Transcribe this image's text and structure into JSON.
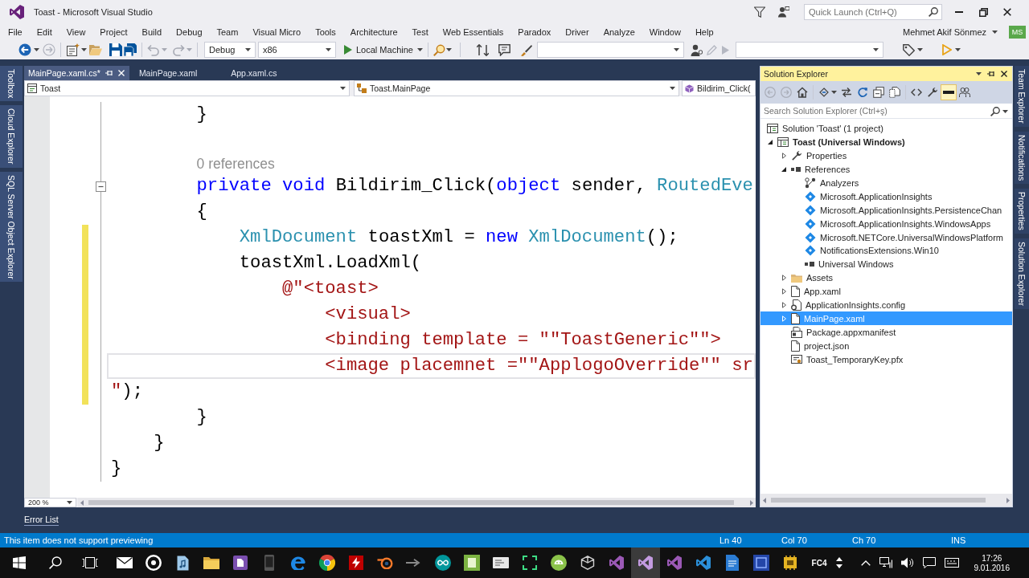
{
  "window": {
    "title": "Toast - Microsoft Visual Studio",
    "quick_launch": {
      "placeholder": "Quick Launch (Ctrl+Q)"
    }
  },
  "menu": {
    "items": [
      "File",
      "Edit",
      "View",
      "Project",
      "Build",
      "Debug",
      "Team",
      "Visual Micro",
      "Tools",
      "Architecture",
      "Test",
      "Web Essentials",
      "Paradox",
      "Driver",
      "Analyze",
      "Window",
      "Help"
    ],
    "user": "Mehmet Akif Sönmez",
    "avatar_initials": "MS"
  },
  "toolbar": {
    "configuration": "Debug",
    "platform": "x86",
    "start_target": "Local Machine"
  },
  "left_dock_tabs": [
    "Toolbox",
    "Cloud Explorer",
    "SQL Server Object Explorer"
  ],
  "document_tabs": [
    {
      "label": "MainPage.xaml.cs*",
      "selected": true
    },
    {
      "label": "MainPage.xaml",
      "selected": false
    },
    {
      "label": "App.xaml.cs",
      "selected": false
    }
  ],
  "navigation_bar": {
    "project": "Toast",
    "type": "Toast.MainPage",
    "member": "Bildirim_Click("
  },
  "editor": {
    "lines": [
      {
        "kind": "code",
        "tokens": [
          {
            "kind": "plain",
            "text": "        }"
          }
        ],
        "current": false,
        "changed": false,
        "foldable": false
      },
      {
        "kind": "blank",
        "current": false,
        "changed": false,
        "foldable": false
      },
      {
        "kind": "codelens",
        "text": "        0 references",
        "current": false,
        "changed": false,
        "foldable": false
      },
      {
        "kind": "code",
        "tokens": [
          {
            "kind": "keyword",
            "text": "        private void"
          },
          {
            "kind": "plain",
            "text": " Bildirim_Click("
          },
          {
            "kind": "keyword",
            "text": "object"
          },
          {
            "kind": "plain",
            "text": " sender, "
          },
          {
            "kind": "type",
            "text": "RoutedEve"
          }
        ],
        "current": false,
        "changed": false,
        "foldable": true
      },
      {
        "kind": "code",
        "tokens": [
          {
            "kind": "plain",
            "text": "        {"
          }
        ],
        "current": false,
        "changed": false,
        "foldable": false
      },
      {
        "kind": "code",
        "tokens": [
          {
            "kind": "type",
            "text": "            XmlDocument"
          },
          {
            "kind": "plain",
            "text": " toastXml = "
          },
          {
            "kind": "keyword",
            "text": "new "
          },
          {
            "kind": "type",
            "text": "XmlDocument"
          },
          {
            "kind": "plain",
            "text": "();"
          }
        ],
        "current": false,
        "changed": true,
        "foldable": false
      },
      {
        "kind": "code",
        "tokens": [
          {
            "kind": "plain",
            "text": "            toastXml.LoadXml("
          }
        ],
        "current": false,
        "changed": true,
        "foldable": false
      },
      {
        "kind": "code",
        "tokens": [
          {
            "kind": "string",
            "text": "                @\"<toast>"
          }
        ],
        "current": false,
        "changed": true,
        "foldable": false
      },
      {
        "kind": "code",
        "tokens": [
          {
            "kind": "string",
            "text": "                    <visual>"
          }
        ],
        "current": false,
        "changed": true,
        "foldable": false
      },
      {
        "kind": "code",
        "tokens": [
          {
            "kind": "string",
            "text": "                    <binding template = \"\"ToastGeneric\"\">"
          }
        ],
        "current": false,
        "changed": true,
        "foldable": false
      },
      {
        "kind": "code",
        "tokens": [
          {
            "kind": "string",
            "text": "                    <image placemnet =\"\"ApplogoOverride\"\" sr"
          }
        ],
        "current": true,
        "changed": true,
        "foldable": false
      },
      {
        "kind": "code",
        "tokens": [
          {
            "kind": "string",
            "text": "\""
          },
          {
            "kind": "plain",
            "text": ");"
          }
        ],
        "current": false,
        "changed": true,
        "foldable": false
      },
      {
        "kind": "code",
        "tokens": [
          {
            "kind": "plain",
            "text": "        }"
          }
        ],
        "current": false,
        "changed": false,
        "foldable": false
      },
      {
        "kind": "code",
        "tokens": [
          {
            "kind": "plain",
            "text": "    }"
          }
        ],
        "current": false,
        "changed": false,
        "foldable": false
      },
      {
        "kind": "code",
        "tokens": [
          {
            "kind": "plain",
            "text": "}"
          }
        ],
        "current": false,
        "changed": false,
        "foldable": false
      }
    ],
    "zoom": "200 %"
  },
  "solution_explorer": {
    "title": "Solution Explorer",
    "toolbar": [
      {
        "kind": "back",
        "on": false
      },
      {
        "kind": "forward",
        "on": false
      },
      {
        "kind": "home",
        "on": false
      },
      {
        "kind": "sync",
        "on": false
      },
      {
        "kind": "pending",
        "on": false
      },
      {
        "kind": "refresh",
        "on": false
      },
      {
        "kind": "collapse",
        "on": false
      },
      {
        "kind": "showall",
        "on": false
      },
      {
        "kind": "code",
        "on": false
      },
      {
        "kind": "properties",
        "on": false
      },
      {
        "kind": "preview",
        "on": true
      },
      {
        "kind": "people",
        "on": false
      }
    ],
    "search": {
      "placeholder": "Search Solution Explorer (Ctrl+ş)"
    },
    "tree": [
      {
        "label": "Solution 'Toast' (1 project)",
        "kind": "solution",
        "selected": false,
        "children": [
          {
            "label": "Toast (Universal Windows)",
            "kind": "project",
            "expanded": true,
            "selected": false,
            "children": [
              {
                "label": "Properties",
                "kind": "properties",
                "expanded": false,
                "selected": false
              },
              {
                "label": "References",
                "kind": "references",
                "expanded": true,
                "selected": false,
                "children": [
                  {
                    "label": "Analyzers",
                    "kind": "analyzers",
                    "selected": false
                  },
                  {
                    "label": "Microsoft.ApplicationInsights",
                    "kind": "reference",
                    "selected": false
                  },
                  {
                    "label": "Microsoft.ApplicationInsights.PersistenceChan",
                    "kind": "reference",
                    "selected": false
                  },
                  {
                    "label": "Microsoft.ApplicationInsights.WindowsApps",
                    "kind": "reference",
                    "selected": false
                  },
                  {
                    "label": "Microsoft.NETCore.UniversalWindowsPlatform",
                    "kind": "reference",
                    "selected": false
                  },
                  {
                    "label": "NotificationsExtensions.Win10",
                    "kind": "reference",
                    "selected": false
                  },
                  {
                    "label": "Universal Windows",
                    "kind": "sdk",
                    "selected": false
                  }
                ]
              },
              {
                "label": "Assets",
                "kind": "folder",
                "expanded": false,
                "selected": false
              },
              {
                "label": "App.xaml",
                "kind": "xaml",
                "expanded": false,
                "selected": false
              },
              {
                "label": "ApplicationInsights.config",
                "kind": "config",
                "expanded": false,
                "selected": false
              },
              {
                "label": "MainPage.xaml",
                "kind": "xaml",
                "expanded": false,
                "selected": true
              },
              {
                "label": "Package.appxmanifest",
                "kind": "manifest",
                "selected": false
              },
              {
                "label": "project.json",
                "kind": "json",
                "selected": false
              },
              {
                "label": "Toast_TemporaryKey.pfx",
                "kind": "certificate",
                "selected": false
              }
            ]
          }
        ]
      }
    ]
  },
  "right_dock_tabs": [
    "Team Explorer",
    "Notifications",
    "Properties",
    "Solution Explorer"
  ],
  "bottom_dock_tabs": [
    "Error List"
  ],
  "status_bar": {
    "message": "This item does not support previewing",
    "line": "Ln 40",
    "column": "Col 70",
    "character": "Ch 70",
    "mode": "INS"
  },
  "taskbar": {
    "items": [
      {
        "kind": "start",
        "selected": false
      },
      {
        "kind": "search",
        "selected": false
      },
      {
        "kind": "taskview",
        "selected": false
      },
      {
        "kind": "mail",
        "selected": false
      },
      {
        "kind": "media",
        "selected": false
      },
      {
        "kind": "music",
        "selected": false
      },
      {
        "kind": "folder",
        "selected": false
      },
      {
        "kind": "figure",
        "selected": false
      },
      {
        "kind": "phone",
        "selected": false
      },
      {
        "kind": "edge",
        "selected": false
      },
      {
        "kind": "chrome",
        "selected": false
      },
      {
        "kind": "filezilla",
        "selected": false
      },
      {
        "kind": "blender",
        "selected": false
      },
      {
        "kind": "arrow",
        "selected": false
      },
      {
        "kind": "arduino",
        "selected": false
      },
      {
        "kind": "greentile",
        "selected": false
      },
      {
        "kind": "card",
        "selected": false
      },
      {
        "kind": "frame",
        "selected": false
      },
      {
        "kind": "android",
        "selected": false
      },
      {
        "kind": "unity",
        "selected": false
      },
      {
        "kind": "vspurple",
        "selected": false
      },
      {
        "kind": "vs",
        "selected": true
      },
      {
        "kind": "vspurple",
        "selected": false
      },
      {
        "kind": "vsblue",
        "selected": false
      },
      {
        "kind": "document",
        "selected": false
      },
      {
        "kind": "bluetile",
        "selected": false
      },
      {
        "kind": "chip",
        "selected": false
      },
      {
        "kind": "label",
        "label": "FC4",
        "selected": false
      }
    ],
    "time": "17:26",
    "date": "9.01.2016"
  }
}
